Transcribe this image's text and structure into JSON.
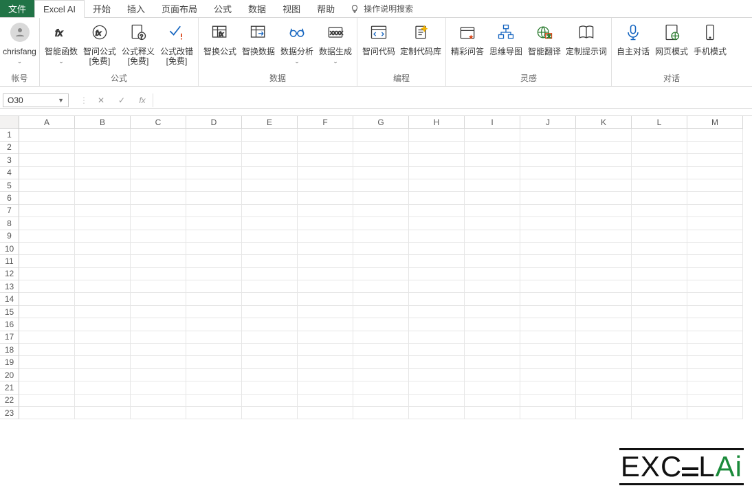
{
  "tabs": {
    "file": "文件",
    "excel_ai": "Excel AI",
    "home": "开始",
    "insert": "插入",
    "layout": "页面布局",
    "formula": "公式",
    "data": "数据",
    "view": "视图",
    "help": "帮助",
    "search_hint": "操作说明搜索"
  },
  "ribbon": {
    "account": {
      "name": "chrisfang",
      "label": "帐号"
    },
    "formula_group": {
      "fn": "智能函数",
      "ask": "智问公式",
      "ask2": "[免费]",
      "explain": "公式释义",
      "explain2": "[免费]",
      "fix": "公式改错",
      "fix2": "[免费]",
      "label": "公式"
    },
    "data_group": {
      "swap_formula": "智换公式",
      "swap_data": "智换数据",
      "analysis": "数据分析",
      "gen": "数据生成",
      "label": "数据"
    },
    "code_group": {
      "ask_code": "智问代码",
      "custom_lib": "定制代码库",
      "label": "编程"
    },
    "inspire_group": {
      "qa": "精彩问答",
      "mindmap": "思维导图",
      "translate": "智能翻译",
      "prompt": "定制提示词",
      "label": "灵感"
    },
    "dialog_group": {
      "self": "自主对话",
      "web": "网页模式",
      "mobile": "手机模式",
      "label": "对话"
    }
  },
  "formula_bar": {
    "name_box": "O30",
    "value": ""
  },
  "columns": [
    "A",
    "B",
    "C",
    "D",
    "E",
    "F",
    "G",
    "H",
    "I",
    "J",
    "K",
    "L",
    "M"
  ],
  "rows": [
    "1",
    "2",
    "3",
    "4",
    "5",
    "6",
    "7",
    "8",
    "9",
    "10",
    "11",
    "12",
    "13",
    "14",
    "15",
    "16",
    "17",
    "18",
    "19",
    "20",
    "21",
    "22",
    "23"
  ],
  "watermark": {
    "left": "EXC",
    "right": "L",
    "ai": "Ai"
  }
}
